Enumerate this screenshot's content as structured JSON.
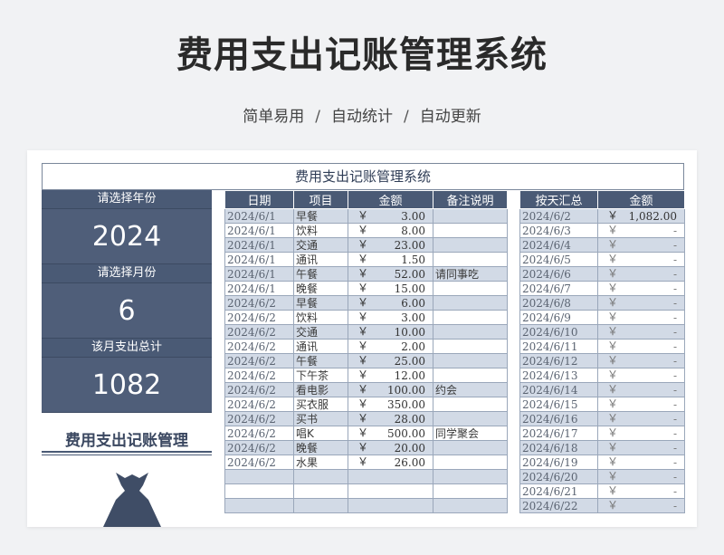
{
  "header": {
    "title": "费用支出记账管理系统",
    "tags": [
      "简单易用",
      "自动统计",
      "自动更新"
    ],
    "separator": "/"
  },
  "sheet": {
    "title": "费用支出记账管理系统",
    "left": {
      "year_label": "请选择年份",
      "year_value": "2024",
      "month_label": "请选择月份",
      "month_value": "6",
      "total_label": "该月支出总计",
      "total_value": "1082",
      "brand": "费用支出记账管理"
    },
    "records": {
      "columns": [
        "日期",
        "项目",
        "金额",
        "备注说明"
      ],
      "currency": "￥",
      "rows": [
        {
          "date": "2024/6/1",
          "item": "早餐",
          "amount": "3.00",
          "note": ""
        },
        {
          "date": "2024/6/1",
          "item": "饮料",
          "amount": "8.00",
          "note": ""
        },
        {
          "date": "2024/6/1",
          "item": "交通",
          "amount": "23.00",
          "note": ""
        },
        {
          "date": "2024/6/1",
          "item": "通讯",
          "amount": "1.50",
          "note": ""
        },
        {
          "date": "2024/6/1",
          "item": "午餐",
          "amount": "52.00",
          "note": "请同事吃"
        },
        {
          "date": "2024/6/1",
          "item": "晚餐",
          "amount": "15.00",
          "note": ""
        },
        {
          "date": "2024/6/2",
          "item": "早餐",
          "amount": "6.00",
          "note": ""
        },
        {
          "date": "2024/6/2",
          "item": "饮料",
          "amount": "3.00",
          "note": ""
        },
        {
          "date": "2024/6/2",
          "item": "交通",
          "amount": "10.00",
          "note": ""
        },
        {
          "date": "2024/6/2",
          "item": "通讯",
          "amount": "2.00",
          "note": ""
        },
        {
          "date": "2024/6/2",
          "item": "午餐",
          "amount": "25.00",
          "note": ""
        },
        {
          "date": "2024/6/2",
          "item": "下午茶",
          "amount": "12.00",
          "note": ""
        },
        {
          "date": "2024/6/2",
          "item": "看电影",
          "amount": "100.00",
          "note": "约会"
        },
        {
          "date": "2024/6/2",
          "item": "买衣服",
          "amount": "350.00",
          "note": ""
        },
        {
          "date": "2024/6/2",
          "item": "买书",
          "amount": "28.00",
          "note": ""
        },
        {
          "date": "2024/6/2",
          "item": "唱K",
          "amount": "500.00",
          "note": "同学聚会"
        },
        {
          "date": "2024/6/2",
          "item": "晚餐",
          "amount": "20.00",
          "note": ""
        },
        {
          "date": "2024/6/2",
          "item": "水果",
          "amount": "26.00",
          "note": ""
        },
        {
          "date": "",
          "item": "",
          "amount": "",
          "note": ""
        },
        {
          "date": "",
          "item": "",
          "amount": "",
          "note": ""
        },
        {
          "date": "",
          "item": "",
          "amount": "",
          "note": ""
        }
      ]
    },
    "daily": {
      "columns": [
        "按天汇总",
        "金额"
      ],
      "currency": "￥",
      "rows": [
        {
          "date": "2024/6/2",
          "amount": "1,082.00"
        },
        {
          "date": "2024/6/3",
          "amount": "-"
        },
        {
          "date": "2024/6/4",
          "amount": "-"
        },
        {
          "date": "2024/6/5",
          "amount": "-"
        },
        {
          "date": "2024/6/6",
          "amount": "-"
        },
        {
          "date": "2024/6/7",
          "amount": "-"
        },
        {
          "date": "2024/6/8",
          "amount": "-"
        },
        {
          "date": "2024/6/9",
          "amount": "-"
        },
        {
          "date": "2024/6/10",
          "amount": "-"
        },
        {
          "date": "2024/6/11",
          "amount": "-"
        },
        {
          "date": "2024/6/12",
          "amount": "-"
        },
        {
          "date": "2024/6/13",
          "amount": "-"
        },
        {
          "date": "2024/6/14",
          "amount": "-"
        },
        {
          "date": "2024/6/15",
          "amount": "-"
        },
        {
          "date": "2024/6/16",
          "amount": "-"
        },
        {
          "date": "2024/6/17",
          "amount": "-"
        },
        {
          "date": "2024/6/18",
          "amount": "-"
        },
        {
          "date": "2024/6/19",
          "amount": "-"
        },
        {
          "date": "2024/6/20",
          "amount": "-"
        },
        {
          "date": "2024/6/21",
          "amount": "-"
        },
        {
          "date": "2024/6/22",
          "amount": "-"
        }
      ]
    }
  },
  "colors": {
    "header_bg": "#4a5a75",
    "stripe": "#d2dae6",
    "page_bg": "#f1f2f4"
  }
}
